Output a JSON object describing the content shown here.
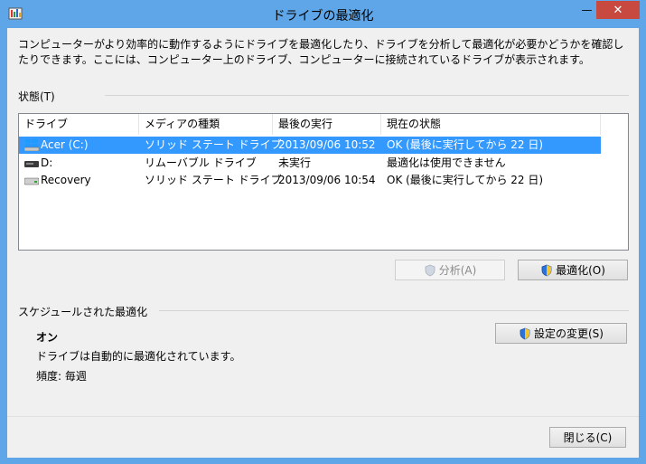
{
  "window": {
    "title": "ドライブの最適化",
    "min_glyph": "—",
    "max_glyph": "☐",
    "close_glyph": "✕"
  },
  "description": "コンピューターがより効率的に動作するようにドライブを最適化したり、ドライブを分析して最適化が必要かどうかを確認したりできます。ここには、コンピューター上のドライブ、コンピューターに接続されているドライブが表示されます。",
  "status_section": {
    "label": "状態(T)"
  },
  "drives": {
    "columns": [
      "ドライブ",
      "メディアの種類",
      "最後の実行",
      "現在の状態"
    ],
    "rows": [
      {
        "name": "Acer (C:)",
        "media": "ソリッド ステート ドライブ",
        "last_run": "2013/09/06 10:52",
        "status": "OK (最後に実行してから 22 日)",
        "icon": "windows-drive-icon"
      },
      {
        "name": "D:",
        "media": "リムーバブル ドライブ",
        "last_run": "未実行",
        "status": "最適化は使用できません",
        "icon": "removable-drive-icon"
      },
      {
        "name": "Recovery",
        "media": "ソリッド ステート ドライブ",
        "last_run": "2013/09/06 10:54",
        "status": "OK (最後に実行してから 22 日)",
        "icon": "hard-drive-icon"
      }
    ],
    "selected_index": 0
  },
  "actions": {
    "analyze_label": "分析(A)",
    "optimize_label": "最適化(O)"
  },
  "schedule": {
    "label": "スケジュールされた最適化",
    "status": "オン",
    "detail": "ドライブは自動的に最適化されています。",
    "frequency": "頻度: 毎週",
    "change_label": "設定の変更(S)"
  },
  "footer": {
    "close_label": "閉じる(C)"
  },
  "colors": {
    "frame": "#5ea6e7",
    "selection": "#3399ff",
    "close": "#c7493f"
  }
}
